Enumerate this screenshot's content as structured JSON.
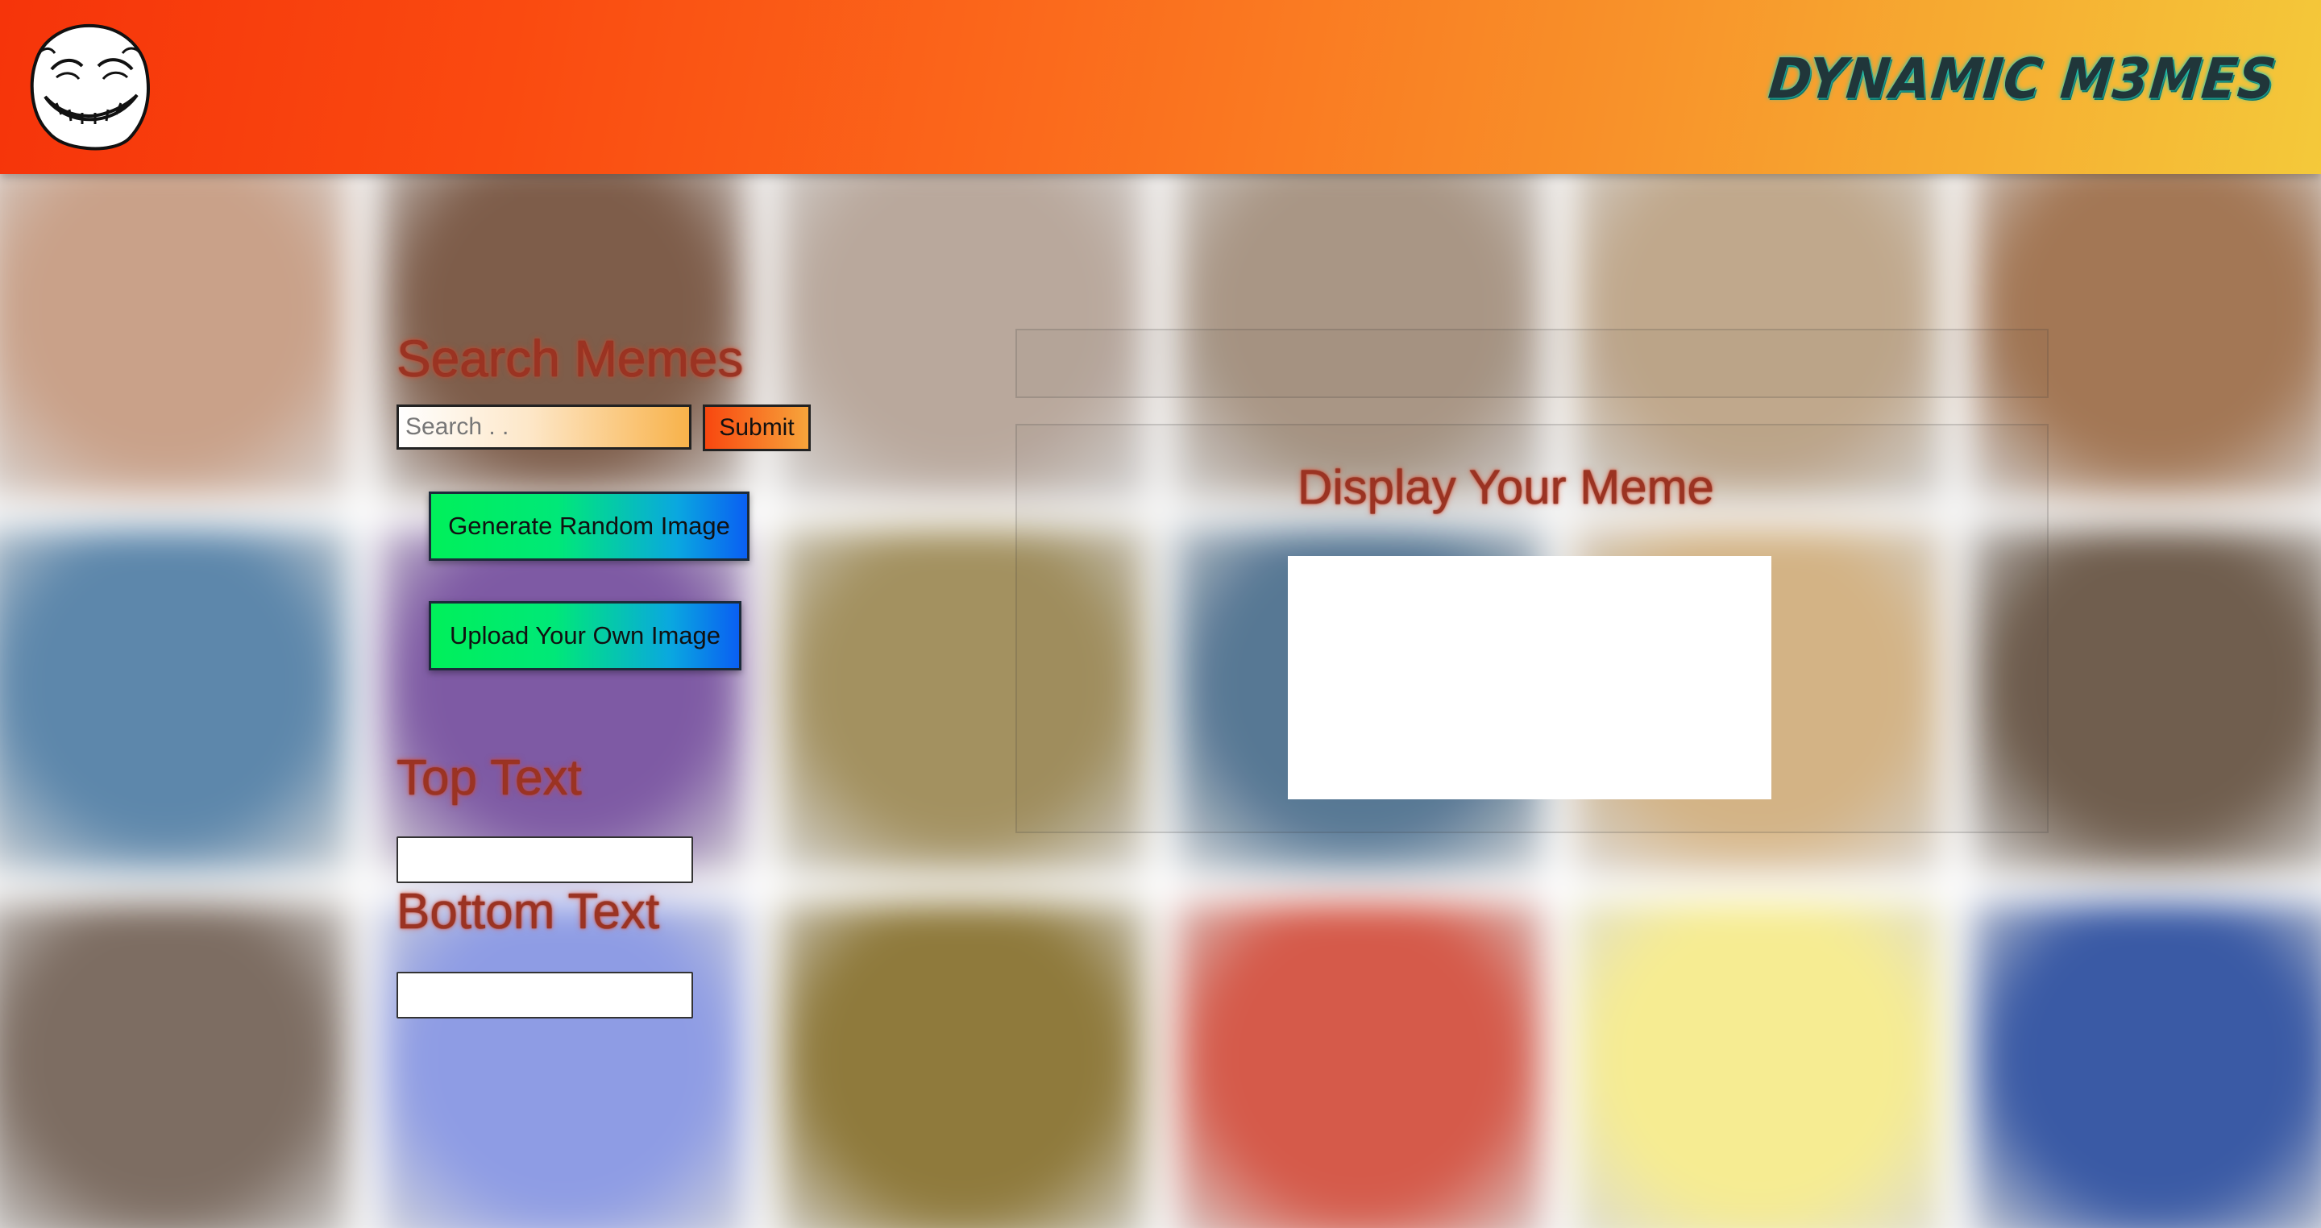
{
  "header": {
    "brand": "DYNAMIC M3MES",
    "logo_icon": "troll-face-icon",
    "gradient_colors": [
      "#f6340a",
      "#fb6a1c",
      "#f4c93a"
    ],
    "brand_color": "#20363a",
    "brand_glow": "#2bdcc8"
  },
  "background": {
    "description_icon": "meme-collage-background",
    "tile_colors": [
      "#c9a189",
      "#7e5d4a",
      "#b9a89c",
      "#a99685",
      "#c0a88c",
      "#a37755",
      "#5d87ab",
      "#7e5aa4",
      "#a39160",
      "#5a7b98",
      "#d9b889",
      "#705e4e",
      "#7d6d62",
      "#8e9ce4",
      "#8f7a3c",
      "#d55a4a",
      "#f6ec92",
      "#3a5aa5"
    ]
  },
  "search": {
    "heading": "Search Memes",
    "placeholder": "Search . .",
    "value": "",
    "submit_label": "Submit"
  },
  "actions": {
    "random_label": "Generate Random Image",
    "upload_label": "Upload Your Own Image"
  },
  "captions": {
    "top_label": "Top Text",
    "top_value": "",
    "bottom_label": "Bottom Text",
    "bottom_value": ""
  },
  "display": {
    "heading": "Display Your Meme"
  },
  "theme": {
    "heading_color": "#9b3322",
    "button_gradient": [
      "#00f05a",
      "#0a5ff2"
    ]
  }
}
